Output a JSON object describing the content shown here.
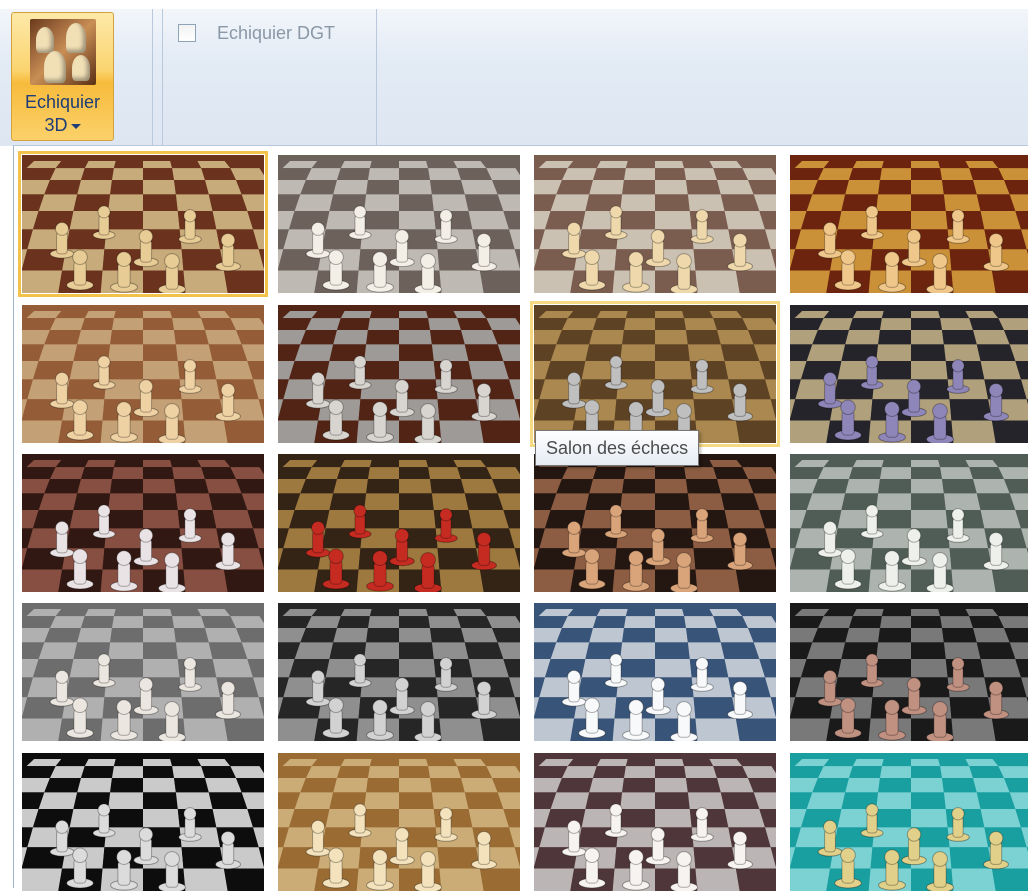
{
  "ribbon": {
    "board3d_button": {
      "line1": "Echiquier",
      "line2": "3D",
      "icon": "chess-pieces-icon",
      "state": "pressed"
    },
    "dgt_checkbox": {
      "label": "Echiquier DGT",
      "checked": false,
      "enabled": false
    }
  },
  "gallery": {
    "selected_index": 0,
    "hover_index": 6,
    "tooltip": "Salon des échecs",
    "tiles": [
      {
        "theme": "dark-wood-board",
        "colors": {
          "light": "#e3c38c",
          "dark": "#7a3a22",
          "piece": "#e8cc96"
        }
      },
      {
        "theme": "grey-marble-board",
        "colors": {
          "light": "#d9d3cc",
          "dark": "#7c7068",
          "piece": "#f4efe6"
        }
      },
      {
        "theme": "light-marble-board",
        "colors": {
          "light": "#e8dccb",
          "dark": "#8c6a5c",
          "piece": "#efd9ac"
        }
      },
      {
        "theme": "orange-wood-board",
        "colors": {
          "light": "#e7a640",
          "dark": "#7b2a10",
          "piece": "#f0c78a"
        }
      },
      {
        "theme": "plain-wood-board",
        "colors": {
          "light": "#e0b787",
          "dark": "#a96a3f",
          "piece": "#efd2a4"
        }
      },
      {
        "theme": "fireplace-room",
        "colors": {
          "light": "#b4b0ac",
          "dark": "#5e2a1a",
          "piece": "#d8d4d0"
        }
      },
      {
        "theme": "chess-salon",
        "colors": {
          "light": "#c29b5c",
          "dark": "#6b4c2a",
          "piece": "#bfbfbf"
        }
      },
      {
        "theme": "egyptian-statues",
        "colors": {
          "light": "#c9b88e",
          "dark": "#2b2a30",
          "piece": "#8e86b8"
        }
      },
      {
        "theme": "robot-player",
        "colors": {
          "light": "#9a5a4c",
          "dark": "#3a1c16",
          "piece": "#e9e3e6"
        }
      },
      {
        "theme": "santa-player",
        "colors": {
          "light": "#b48a48",
          "dark": "#3c2a1a",
          "piece": "#c62b22"
        }
      },
      {
        "theme": "lady-player",
        "colors": {
          "light": "#a06a4c",
          "dark": "#2a1a14",
          "piece": "#d9a47a"
        }
      },
      {
        "theme": "green-marble-board",
        "colors": {
          "light": "#c5ccc7",
          "dark": "#5b6a62",
          "piece": "#eef0ec"
        }
      },
      {
        "theme": "silver-marble-board",
        "colors": {
          "light": "#c9c9c9",
          "dark": "#7d7d7d",
          "piece": "#ebe6df"
        }
      },
      {
        "theme": "dark-grey-board",
        "colors": {
          "light": "#a3a3a3",
          "dark": "#2c2c2c",
          "piece": "#d2d2d2"
        }
      },
      {
        "theme": "ice-board",
        "colors": {
          "light": "#d9e3ee",
          "dark": "#40608a",
          "piece": "#f7f9fb"
        }
      },
      {
        "theme": "dark-metal-board",
        "colors": {
          "light": "#8a8a8a",
          "dark": "#1e1e1e",
          "piece": "#c09080"
        }
      },
      {
        "theme": "black-white-board",
        "colors": {
          "light": "#e6e6e6",
          "dark": "#0f0f0f",
          "piece": "#dcdcdc"
        }
      },
      {
        "theme": "light-wood-board",
        "colors": {
          "light": "#e8c487",
          "dark": "#b07c3c",
          "piece": "#f3e2bc"
        }
      },
      {
        "theme": "rose-marble-board",
        "colors": {
          "light": "#d7cfcf",
          "dark": "#5a3e44",
          "piece": "#f6f3f0"
        }
      },
      {
        "theme": "cyan-board",
        "colors": {
          "light": "#8ef0ef",
          "dark": "#1eb6b8",
          "piece": "#e0d08a"
        }
      }
    ]
  }
}
